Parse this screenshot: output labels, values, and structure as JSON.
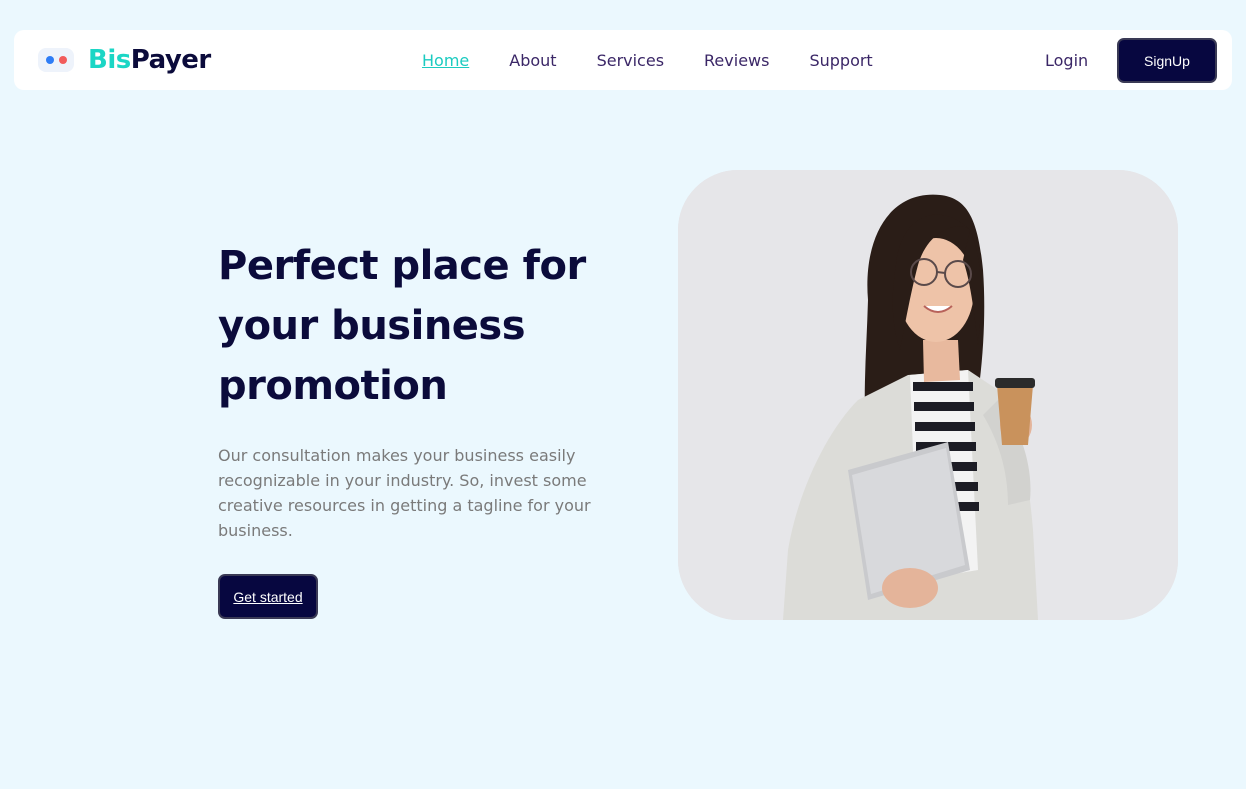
{
  "brand": {
    "part1": "Bis",
    "part2": "Payer",
    "colors": {
      "accent": "#1bd6c5",
      "dark": "#0b0b3b"
    }
  },
  "nav": {
    "items": [
      {
        "label": "Home",
        "active": true
      },
      {
        "label": "About"
      },
      {
        "label": "Services"
      },
      {
        "label": "Reviews"
      },
      {
        "label": "Support"
      }
    ],
    "login": "Login",
    "signup": "SignUp"
  },
  "hero": {
    "title_lines": [
      "Perfect place for",
      "your business",
      "promotion"
    ],
    "description_lines": [
      "Our consultation makes your business easily",
      "recognizable in your industry. So, invest some",
      "creative resources in getting a tagline for your",
      "business."
    ],
    "cta": "Get started"
  },
  "icons": [
    "logo-mark-icon"
  ]
}
